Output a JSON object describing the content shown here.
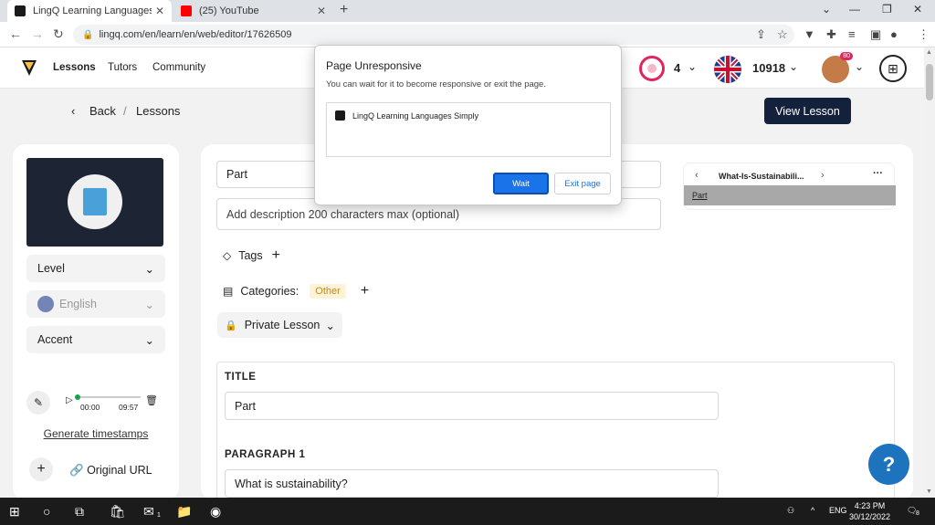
{
  "browser": {
    "tabs": [
      {
        "title": "LingQ Learning Languages Simpl",
        "favicon_color": "#1a1a1a"
      },
      {
        "title": "(25) YouTube",
        "favicon_color": "#ff0000"
      }
    ],
    "url": "lingq.com/en/learn/en/web/editor/17626509"
  },
  "site": {
    "nav": {
      "lessons": "Lessons",
      "tutors": "Tutors",
      "community": "Community"
    },
    "streak": "4",
    "coins": "10918",
    "avatar_badge": "80"
  },
  "breadcrumb": {
    "back": "Back",
    "sep": "/",
    "lessons": "Lessons"
  },
  "view_lesson": "View Lesson",
  "left": {
    "level": "Level",
    "language": "English",
    "accent": "Accent",
    "time_start": "00:00",
    "time_end": "09:57",
    "generate_timestamps": "Generate timestamps",
    "original_url": "Original URL"
  },
  "main": {
    "title_value": "Part",
    "description_placeholder": "Add description 200 characters max (optional)",
    "tags": "Tags",
    "categories": "Categories:",
    "category_chip": "Other",
    "private_lesson": "Private Lesson",
    "section_title": "TITLE",
    "section_title_value": "Part",
    "section_paragraph": "PARAGRAPH 1",
    "paragraph_value": "What is sustainability?"
  },
  "preview": {
    "title": "What-Is-Sustainabili...",
    "part": "Part"
  },
  "help": "?",
  "dialog": {
    "title": "Page Unresponsive",
    "message": "You can wait for it to become responsive or exit the page.",
    "page_item": "LingQ Learning Languages Simply",
    "wait": "Wait",
    "exit": "Exit page"
  },
  "taskbar": {
    "lang": "ENG",
    "time": "4:23 PM",
    "date": "30/12/2022",
    "mail_badge": "1",
    "notif_badge": "8"
  },
  "colors": {
    "accent": "#14213d",
    "wait_button": "#1a73e8",
    "help": "#1e73be",
    "streak": "#e0245e"
  }
}
